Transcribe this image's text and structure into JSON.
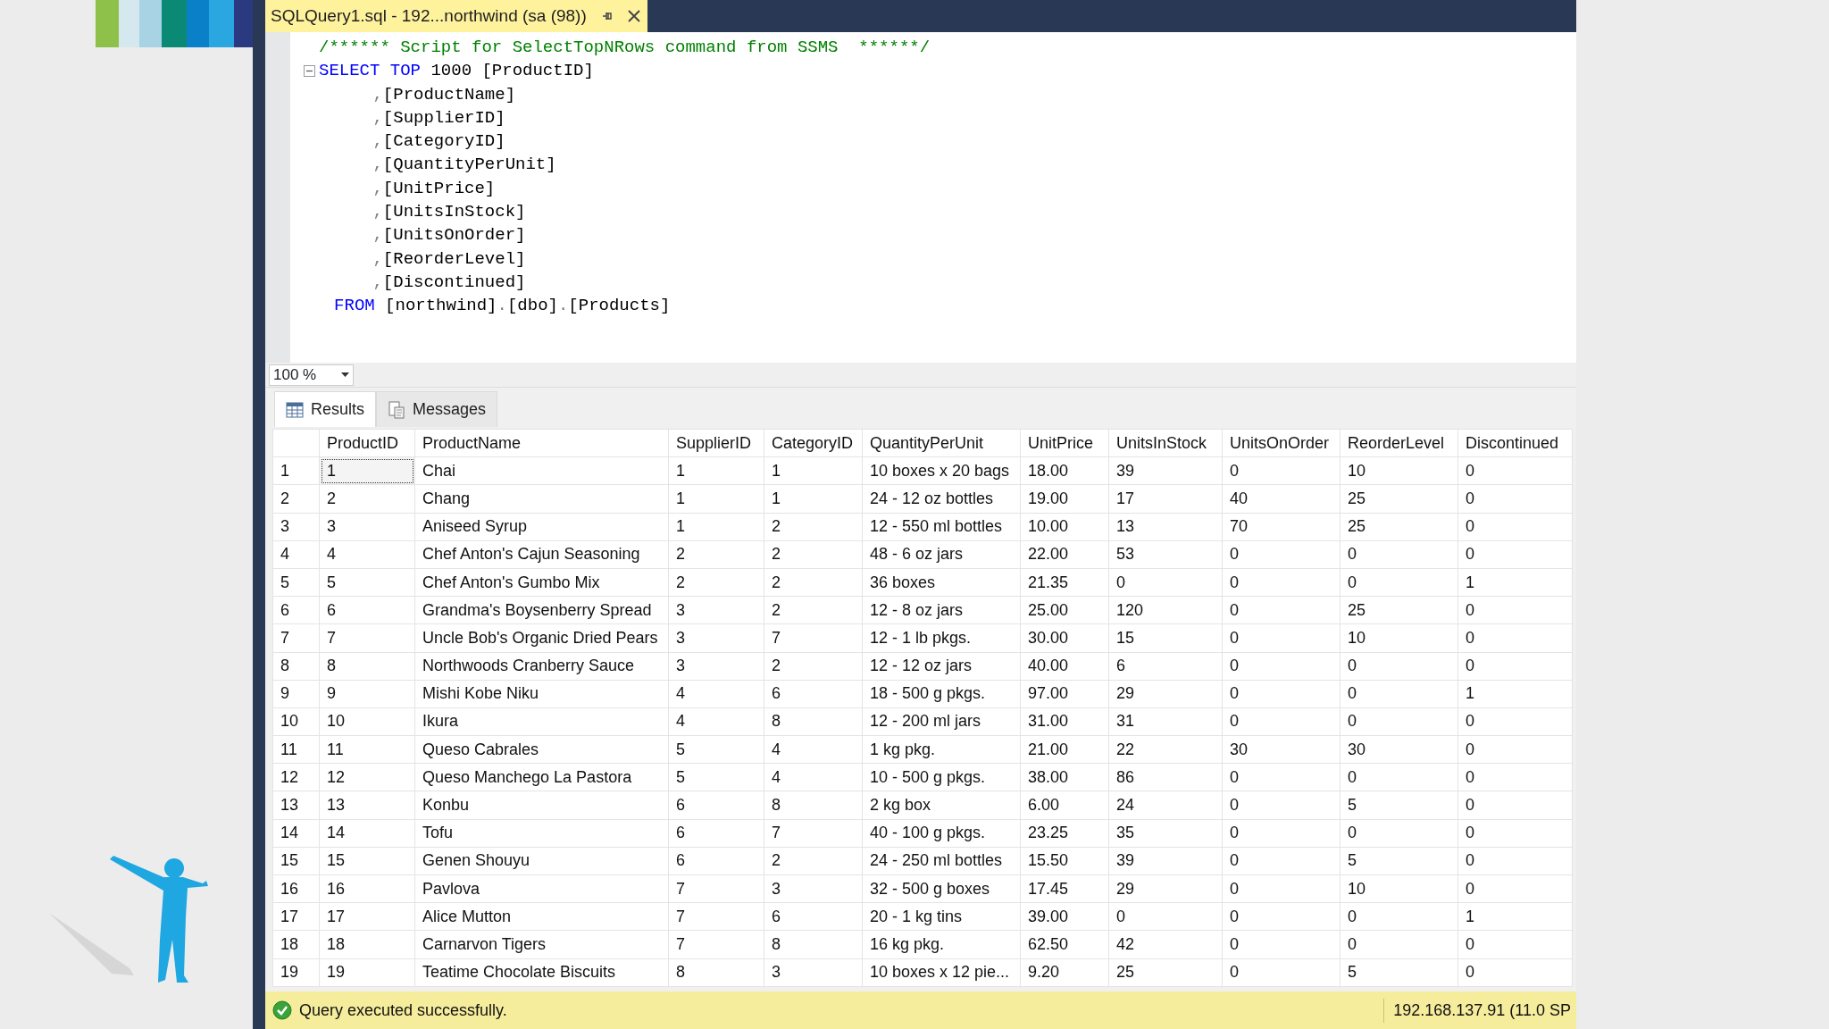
{
  "document_tab": {
    "title": "SQLQuery1.sql - 192...northwind (sa (98))",
    "selected": true
  },
  "editor": {
    "lines": [
      {
        "kind": "comment",
        "fold_marker": false,
        "tokens": [
          {
            "kind": "comment",
            "text": "/****** Script for SelectTopNRows command from SSMS  ******/"
          }
        ]
      },
      {
        "kind": "select",
        "fold_marker": true,
        "tokens": [
          {
            "kind": "keyword",
            "text": "SELECT"
          },
          {
            "kind": "keyword",
            "text": "TOP"
          },
          {
            "kind": "plain",
            "text": "1000"
          },
          {
            "kind": "plain",
            "text": "[ProductID]"
          }
        ]
      },
      {
        "kind": "column",
        "fold_marker": false,
        "tokens": [
          {
            "kind": "punct",
            "text": ","
          },
          {
            "kind": "glued",
            "text": "[ProductName]"
          }
        ]
      },
      {
        "kind": "column",
        "fold_marker": false,
        "tokens": [
          {
            "kind": "punct",
            "text": ","
          },
          {
            "kind": "glued",
            "text": "[SupplierID]"
          }
        ]
      },
      {
        "kind": "column",
        "fold_marker": false,
        "tokens": [
          {
            "kind": "punct",
            "text": ","
          },
          {
            "kind": "glued",
            "text": "[CategoryID]"
          }
        ]
      },
      {
        "kind": "column",
        "fold_marker": false,
        "tokens": [
          {
            "kind": "punct",
            "text": ","
          },
          {
            "kind": "glued",
            "text": "[QuantityPerUnit]"
          }
        ]
      },
      {
        "kind": "column",
        "fold_marker": false,
        "tokens": [
          {
            "kind": "punct",
            "text": ","
          },
          {
            "kind": "glued",
            "text": "[UnitPrice]"
          }
        ]
      },
      {
        "kind": "column",
        "fold_marker": false,
        "tokens": [
          {
            "kind": "punct",
            "text": ","
          },
          {
            "kind": "glued",
            "text": "[UnitsInStock]"
          }
        ]
      },
      {
        "kind": "column",
        "fold_marker": false,
        "tokens": [
          {
            "kind": "punct",
            "text": ","
          },
          {
            "kind": "glued",
            "text": "[UnitsOnOrder]"
          }
        ]
      },
      {
        "kind": "column",
        "fold_marker": false,
        "tokens": [
          {
            "kind": "punct",
            "text": ","
          },
          {
            "kind": "glued",
            "text": "[ReorderLevel]"
          }
        ]
      },
      {
        "kind": "column",
        "fold_marker": false,
        "tokens": [
          {
            "kind": "punct",
            "text": ","
          },
          {
            "kind": "glued",
            "text": "[Discontinued]"
          }
        ]
      },
      {
        "kind": "from",
        "fold_marker": false,
        "tokens": [
          {
            "kind": "keyword",
            "text": "FROM"
          },
          {
            "kind": "plain",
            "text": "[northwind]"
          },
          {
            "kind": "punct",
            "text": "."
          },
          {
            "kind": "glued",
            "text": "[dbo]"
          },
          {
            "kind": "punct",
            "text": "."
          },
          {
            "kind": "glued",
            "text": "[Products]"
          }
        ]
      }
    ]
  },
  "zoom": {
    "value": "100 %"
  },
  "result_tabs": [
    {
      "label": "Results",
      "kind": "grid",
      "selected": true
    },
    {
      "label": "Messages",
      "kind": "messages",
      "selected": false
    }
  ],
  "table": {
    "columns": [
      "ProductID",
      "ProductName",
      "SupplierID",
      "CategoryID",
      "QuantityPerUnit",
      "UnitPrice",
      "UnitsInStock",
      "UnitsOnOrder",
      "ReorderLevel",
      "Discontinued"
    ],
    "rows": [
      {
        "number": "1",
        "focused": true,
        "cells": [
          "1",
          "Chai",
          "1",
          "1",
          "10 boxes x 20 bags",
          "18.00",
          "39",
          "0",
          "10",
          "0"
        ]
      },
      {
        "number": "2",
        "focused": false,
        "cells": [
          "2",
          "Chang",
          "1",
          "1",
          "24 - 12 oz bottles",
          "19.00",
          "17",
          "40",
          "25",
          "0"
        ]
      },
      {
        "number": "3",
        "focused": false,
        "cells": [
          "3",
          "Aniseed Syrup",
          "1",
          "2",
          "12 - 550 ml bottles",
          "10.00",
          "13",
          "70",
          "25",
          "0"
        ]
      },
      {
        "number": "4",
        "focused": false,
        "cells": [
          "4",
          "Chef Anton's Cajun Seasoning",
          "2",
          "2",
          "48 - 6 oz jars",
          "22.00",
          "53",
          "0",
          "0",
          "0"
        ]
      },
      {
        "number": "5",
        "focused": false,
        "cells": [
          "5",
          "Chef Anton's Gumbo Mix",
          "2",
          "2",
          "36 boxes",
          "21.35",
          "0",
          "0",
          "0",
          "1"
        ]
      },
      {
        "number": "6",
        "focused": false,
        "cells": [
          "6",
          "Grandma's Boysenberry Spread",
          "3",
          "2",
          "12 - 8 oz jars",
          "25.00",
          "120",
          "0",
          "25",
          "0"
        ]
      },
      {
        "number": "7",
        "focused": false,
        "cells": [
          "7",
          "Uncle Bob's Organic Dried Pears",
          "3",
          "7",
          "12 - 1 lb pkgs.",
          "30.00",
          "15",
          "0",
          "10",
          "0"
        ]
      },
      {
        "number": "8",
        "focused": false,
        "cells": [
          "8",
          "Northwoods Cranberry Sauce",
          "3",
          "2",
          "12 - 12 oz jars",
          "40.00",
          "6",
          "0",
          "0",
          "0"
        ]
      },
      {
        "number": "9",
        "focused": false,
        "cells": [
          "9",
          "Mishi Kobe Niku",
          "4",
          "6",
          "18 - 500 g pkgs.",
          "97.00",
          "29",
          "0",
          "0",
          "1"
        ]
      },
      {
        "number": "10",
        "focused": false,
        "cells": [
          "10",
          "Ikura",
          "4",
          "8",
          "12 - 200 ml jars",
          "31.00",
          "31",
          "0",
          "0",
          "0"
        ]
      },
      {
        "number": "11",
        "focused": false,
        "cells": [
          "11",
          "Queso Cabrales",
          "5",
          "4",
          "1 kg pkg.",
          "21.00",
          "22",
          "30",
          "30",
          "0"
        ]
      },
      {
        "number": "12",
        "focused": false,
        "cells": [
          "12",
          "Queso Manchego La Pastora",
          "5",
          "4",
          "10 - 500 g pkgs.",
          "38.00",
          "86",
          "0",
          "0",
          "0"
        ]
      },
      {
        "number": "13",
        "focused": false,
        "cells": [
          "13",
          "Konbu",
          "6",
          "8",
          "2 kg box",
          "6.00",
          "24",
          "0",
          "5",
          "0"
        ]
      },
      {
        "number": "14",
        "focused": false,
        "cells": [
          "14",
          "Tofu",
          "6",
          "7",
          "40 - 100 g pkgs.",
          "23.25",
          "35",
          "0",
          "0",
          "0"
        ]
      },
      {
        "number": "15",
        "focused": false,
        "cells": [
          "15",
          "Genen Shouyu",
          "6",
          "2",
          "24 - 250 ml bottles",
          "15.50",
          "39",
          "0",
          "5",
          "0"
        ]
      },
      {
        "number": "16",
        "focused": false,
        "cells": [
          "16",
          "Pavlova",
          "7",
          "3",
          "32 - 500 g boxes",
          "17.45",
          "29",
          "0",
          "10",
          "0"
        ]
      },
      {
        "number": "17",
        "focused": false,
        "cells": [
          "17",
          "Alice Mutton",
          "7",
          "6",
          "20 - 1 kg tins",
          "39.00",
          "0",
          "0",
          "0",
          "1"
        ]
      },
      {
        "number": "18",
        "focused": false,
        "cells": [
          "18",
          "Carnarvon Tigers",
          "7",
          "8",
          "16 kg pkg.",
          "62.50",
          "42",
          "0",
          "0",
          "0"
        ]
      },
      {
        "number": "19",
        "focused": false,
        "cells": [
          "19",
          "Teatime Chocolate Biscuits",
          "8",
          "3",
          "10 boxes x 12 pie...",
          "9.20",
          "25",
          "0",
          "5",
          "0"
        ]
      }
    ]
  },
  "status_bar": {
    "message": "Query executed successfully.",
    "server": "192.168.137.91 (11.0 SP"
  }
}
